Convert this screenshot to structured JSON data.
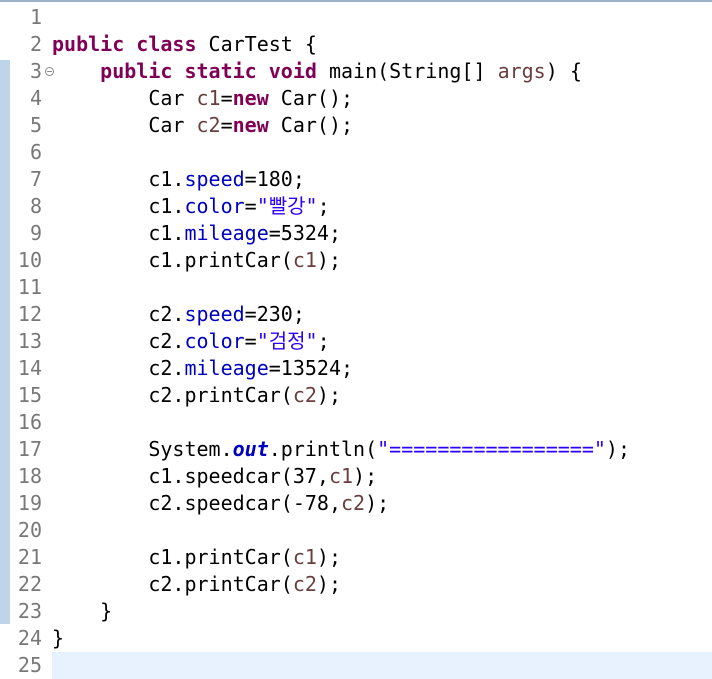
{
  "editor": {
    "line_numbers": [
      "1",
      "2",
      "3",
      "4",
      "5",
      "6",
      "7",
      "8",
      "9",
      "10",
      "11",
      "12",
      "13",
      "14",
      "15",
      "16",
      "17",
      "18",
      "19",
      "20",
      "21",
      "22",
      "23",
      "24",
      "25"
    ],
    "fold_marker_line": "3",
    "tokens": {
      "l2": [
        "public",
        " ",
        "class",
        " CarTest {"
      ],
      "l3": [
        "    ",
        "public",
        " ",
        "static",
        " ",
        "void",
        " main(String[] ",
        "args",
        ") {"
      ],
      "l4": [
        "        Car ",
        "c1",
        "=",
        "new",
        " Car();"
      ],
      "l5": [
        "        Car ",
        "c2",
        "=",
        "new",
        " Car();"
      ],
      "l7": [
        "        c1.",
        "speed",
        "=180;"
      ],
      "l8": [
        "        c1.",
        "color",
        "=",
        "\"빨강\"",
        ";"
      ],
      "l9": [
        "        c1.",
        "mileage",
        "=5324;"
      ],
      "l10": [
        "        c1.printCar(",
        "c1",
        ");"
      ],
      "l12": [
        "        c2.",
        "speed",
        "=230;"
      ],
      "l13": [
        "        c2.",
        "color",
        "=",
        "\"검정\"",
        ";"
      ],
      "l14": [
        "        c2.",
        "mileage",
        "=13524;"
      ],
      "l15": [
        "        c2.printCar(",
        "c2",
        ");"
      ],
      "l17": [
        "        System.",
        "out",
        ".println(",
        "\"=================\"",
        ");"
      ],
      "l18": [
        "        c1.speedcar(37,",
        "c1",
        ");"
      ],
      "l19": [
        "        c2.speedcar(-78,",
        "c2",
        ");"
      ],
      "l21": [
        "        c1.printCar(",
        "c1",
        ");"
      ],
      "l22": [
        "        c2.printCar(",
        "c2",
        ");"
      ],
      "l23": [
        "    }"
      ],
      "l24": [
        "}"
      ]
    }
  },
  "colors": {
    "keyword": "#7f0055",
    "field": "#0000c0",
    "string": "#2a00ff",
    "local_variable": "#6a3e3e",
    "current_line": "#e8f2fe",
    "change_bar": "#6f9fd1",
    "line_number": "#787878"
  }
}
